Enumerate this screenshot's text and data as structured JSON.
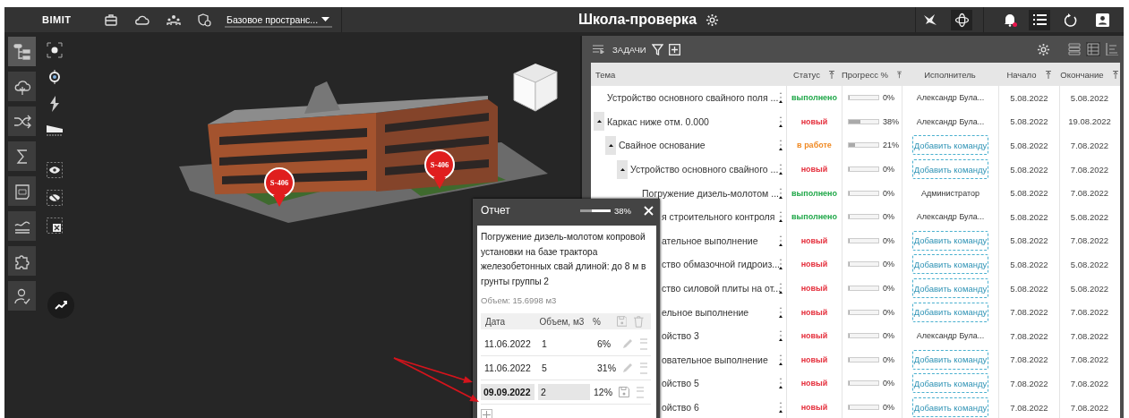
{
  "topbar": {
    "logo": "BIMIT",
    "space_select": {
      "value": "Базовое пространс..."
    },
    "title": "Школа-проверка",
    "view_tools": [
      {
        "kind": "fly",
        "selected": false
      },
      {
        "kind": "orbit",
        "selected": true
      }
    ],
    "notifications": {
      "unread": true
    },
    "menu_tools": [
      {
        "kind": "list",
        "selected": true
      },
      {
        "kind": "history",
        "selected": false
      },
      {
        "kind": "profile",
        "selected": false
      }
    ]
  },
  "sidebar": {
    "items": [
      {
        "kind": "tree",
        "selected": true
      },
      {
        "kind": "cloud",
        "selected": false
      },
      {
        "kind": "shuffle",
        "selected": false
      },
      {
        "kind": "sum",
        "selected": false
      },
      {
        "kind": "plan",
        "selected": false
      },
      {
        "kind": "chart",
        "selected": false
      },
      {
        "kind": "puzzle",
        "selected": false
      },
      {
        "kind": "user",
        "selected": false
      }
    ]
  },
  "markers": [
    {
      "label": "S-406"
    },
    {
      "label": "S-406"
    }
  ],
  "task_panel": {
    "title": "ЗАДАЧИ",
    "columns": [
      {
        "label": "Тема",
        "sortable": false
      },
      {
        "label": "Статус",
        "sortable": true
      },
      {
        "label": "Прогресс %",
        "sortable": true
      },
      {
        "label": "Исполнитель",
        "sortable": false
      },
      {
        "label": "Начало",
        "sortable": true
      },
      {
        "label": "Окончание",
        "sortable": true
      }
    ],
    "rows": [
      {
        "title": "Устройство основного свайного поля ...",
        "status": {
          "text": "выполнено",
          "kind": "done"
        },
        "level": 0,
        "progress": "0%",
        "assignee": {
          "kind": "person",
          "text": "Александр Була..."
        },
        "start": "5.08.2022",
        "end": "5.08.2022"
      },
      {
        "title": "Каркас ниже отм. 0.000",
        "status": {
          "text": "новый",
          "kind": "new"
        },
        "level": 0.38,
        "progress": "38%",
        "assignee": {
          "kind": "person",
          "text": "Александр Була..."
        },
        "start": "5.08.2022",
        "end": "19.08.2022",
        "expanded": true,
        "children": [
          {
            "title": "Свайное основание",
            "status": {
              "text": "в работе",
              "kind": "in_progress"
            },
            "level": 0.21,
            "progress": "21%",
            "assignee": {
              "kind": "add",
              "text": "Добавить команду"
            },
            "start": "5.08.2022",
            "end": "7.08.2022",
            "expanded": true,
            "children": [
              {
                "title": "Устройство основного свайного ...",
                "status": {
                  "text": "новый",
                  "kind": "new"
                },
                "level": 0,
                "progress": "0%",
                "assignee": {
                  "kind": "add",
                  "text": "Добавить команду"
                },
                "start": "5.08.2022",
                "end": "7.08.2022",
                "expanded": true,
                "children": [
                  {
                    "title": "Погружение дизель-молотом ...",
                    "status": {
                      "text": "выполнено",
                      "kind": "done"
                    },
                    "level": 0,
                    "progress": "0%",
                    "assignee": {
                      "kind": "person",
                      "text": "Администратор"
                    },
                    "start": "5.08.2022",
                    "end": "7.08.2022"
                  },
                  {
                    "title": "я строительного контроля",
                    "clipped": true,
                    "status": {
                      "text": "выполнено",
                      "kind": "done"
                    },
                    "level": 0,
                    "progress": "0%",
                    "assignee": {
                      "kind": "person",
                      "text": "Александр Була..."
                    },
                    "start": "5.08.2022",
                    "end": "5.08.2022"
                  },
                  {
                    "title": "ательное выполнение",
                    "clipped": true,
                    "status": {
                      "text": "новый",
                      "kind": "new"
                    },
                    "level": 0,
                    "progress": "0%",
                    "assignee": {
                      "kind": "add",
                      "text": "Добавить команду"
                    },
                    "start": "5.08.2022",
                    "end": "7.08.2022"
                  },
                  {
                    "title": "ство обмазочной гидроиз...",
                    "clipped": true,
                    "status": {
                      "text": "новый",
                      "kind": "new"
                    },
                    "level": 0,
                    "progress": "0%",
                    "assignee": {
                      "kind": "add",
                      "text": "Добавить команду"
                    },
                    "start": "5.08.2022",
                    "end": "5.08.2022"
                  },
                  {
                    "title": "ство силовой плиты на от...",
                    "clipped": true,
                    "status": {
                      "text": "новый",
                      "kind": "new"
                    },
                    "level": 0,
                    "progress": "0%",
                    "assignee": {
                      "kind": "add",
                      "text": "Добавить команду"
                    },
                    "start": "5.08.2022",
                    "end": "5.08.2022"
                  },
                  {
                    "title": "ельное выполнение",
                    "clipped": true,
                    "status": {
                      "text": "новый",
                      "kind": "new"
                    },
                    "level": 0,
                    "progress": "0%",
                    "assignee": {
                      "kind": "add",
                      "text": "Добавить команду"
                    },
                    "start": "7.08.2022",
                    "end": "7.08.2022"
                  },
                  {
                    "title": "ойство 3",
                    "clipped": true,
                    "status": {
                      "text": "новый",
                      "kind": "new"
                    },
                    "level": 0,
                    "progress": "0%",
                    "assignee": {
                      "kind": "person",
                      "text": "Александр Була..."
                    },
                    "start": "7.08.2022",
                    "end": "7.08.2022"
                  },
                  {
                    "title": "овательное выполнение",
                    "clipped": true,
                    "status": {
                      "text": "новый",
                      "kind": "new"
                    },
                    "level": 0,
                    "progress": "0%",
                    "assignee": {
                      "kind": "add",
                      "text": "Добавить команду"
                    },
                    "start": "7.08.2022",
                    "end": "7.08.2022"
                  },
                  {
                    "title": "ойство 5",
                    "clipped": true,
                    "status": {
                      "text": "новый",
                      "kind": "new"
                    },
                    "level": 0,
                    "progress": "0%",
                    "assignee": {
                      "kind": "add",
                      "text": "Добавить команду"
                    },
                    "start": "7.08.2022",
                    "end": "7.08.2022"
                  },
                  {
                    "title": "ойство 6",
                    "clipped": true,
                    "status": {
                      "text": "новый",
                      "kind": "new"
                    },
                    "level": 0,
                    "progress": "0%",
                    "assignee": {
                      "kind": "add",
                      "text": "Добавить команду"
                    },
                    "start": "7.08.2022",
                    "end": "7.08.2022"
                  }
                ]
              }
            ]
          }
        ]
      }
    ]
  },
  "report": {
    "title": "Отчет",
    "level": 0.38,
    "reading": "38%",
    "description": "Погружение дизель-молотом копровой установки на базе трактора железобетонных свай длиной: до 8 м в грунты группы 2",
    "volume": "Объем: 15.6998 м3",
    "columns": [
      "Дата",
      "Объем, м3",
      "%"
    ],
    "entries": [
      {
        "kind": "saved",
        "date": "11.06.2022",
        "volume": "1",
        "percent": "6%"
      },
      {
        "kind": "saved",
        "date": "11.06.2022",
        "volume": "5",
        "percent": "31%"
      },
      {
        "kind": "editing",
        "date": "09.09.2022",
        "volume": "2",
        "percent": "12%"
      }
    ]
  }
}
